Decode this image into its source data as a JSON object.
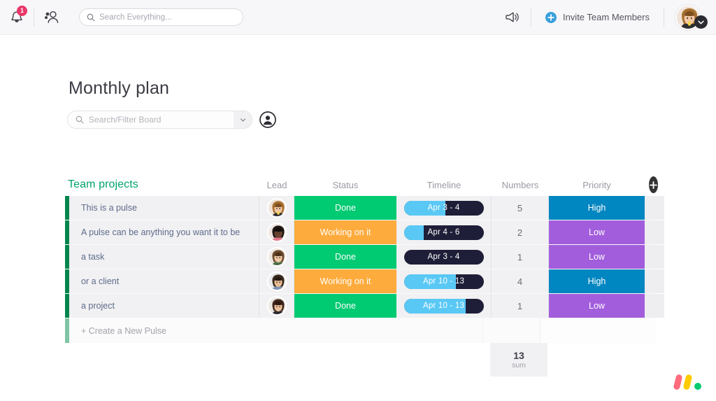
{
  "topbar": {
    "notifications_badge": "1",
    "notifications_icon": "bell-icon",
    "team_icon": "people-icon",
    "megaphone_icon": "megaphone-icon",
    "search": {
      "value": "",
      "placeholder": "Search Everything..."
    },
    "invite_label": "Invite Team Members",
    "invite_icon": "plus-circle-icon",
    "profile_chevron_icon": "chevron-down-icon",
    "avatar": "user-avatar"
  },
  "board": {
    "title": "Monthly plan",
    "search": {
      "value": "",
      "placeholder": "Search/Filter Board"
    },
    "search_icon": "search-icon",
    "dropdown_icon": "chevron-down-icon",
    "person_filter_icon": "person-circle-icon"
  },
  "table": {
    "group_name": "Team projects",
    "add_column_icon": "plus-icon",
    "columns": [
      "Lead",
      "Status",
      "Timeline",
      "Numbers",
      "Priority"
    ],
    "add_row_label": "+ Create a New Pulse",
    "summary": {
      "value": "13",
      "label": "sum"
    },
    "rows": [
      {
        "name": "This is a pulse",
        "lead": "avatar-blonde-woman",
        "status": "Done",
        "status_color": "#00CA72",
        "timeline": "Apr 3 - 4",
        "timeline_progress": 52,
        "number": "5",
        "priority": "High",
        "priority_color": "#0086C0"
      },
      {
        "name": "A pulse can be anything you want it to be",
        "lead": "avatar-man-dark",
        "status": "Working on it",
        "status_color": "#FDAB3D",
        "timeline": "Apr 4 - 6",
        "timeline_progress": 25,
        "number": "2",
        "priority": "Low",
        "priority_color": "#A25DDC"
      },
      {
        "name": "a task",
        "lead": "avatar-woman-glasses",
        "status": "Done",
        "status_color": "#00CA72",
        "timeline": "Apr 3 - 4",
        "timeline_progress": 0,
        "number": "1",
        "priority": "Low",
        "priority_color": "#A25DDC"
      },
      {
        "name": "or a client",
        "lead": "avatar-bearded-man",
        "status": "Working on it",
        "status_color": "#FDAB3D",
        "timeline": "Apr 10 - 13",
        "timeline_progress": 65,
        "number": "4",
        "priority": "High",
        "priority_color": "#0086C0"
      },
      {
        "name": "a project",
        "lead": "avatar-brunette-woman",
        "status": "Done",
        "status_color": "#00CA72",
        "timeline": "Apr 10 - 13",
        "timeline_progress": 78,
        "number": "1",
        "priority": "Low",
        "priority_color": "#A25DDC"
      }
    ]
  },
  "brand": {
    "logo_icon": "monday-logo",
    "colors": {
      "red": "#FF6C7D",
      "yellow": "#FFCB00",
      "green": "#00CA72"
    }
  }
}
